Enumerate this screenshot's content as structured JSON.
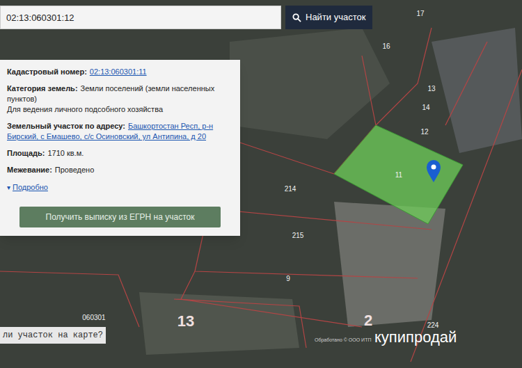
{
  "search": {
    "value": "02:13:060301:12",
    "button": "Найти участок"
  },
  "info": {
    "fields": [
      {
        "label": "Кадастровый номер:",
        "value": "02:13:060301:11",
        "kind": "link"
      },
      {
        "label": "Категория земель:",
        "value": "Земли поселений (земли населенных пунктов)",
        "kind": "text",
        "note": "Для ведения личного подсобного хозяйства"
      },
      {
        "label": "Земельный участок по адресу:",
        "value": "Башкортостан Респ, р-н Бирский, с Емашево, с/с Осиновский, ул Антипина, д 20",
        "kind": "link"
      },
      {
        "label": "Площадь:",
        "value": "1710 кв.м.",
        "kind": "text"
      },
      {
        "label": "Межевание:",
        "value": "Проведено",
        "kind": "text"
      }
    ],
    "details": {
      "icon": "▾",
      "label": "Подробно",
      "expanded": false
    },
    "button": "Получить выписку из ЕГРН на участок"
  },
  "map": {
    "labels": [
      {
        "text": "17",
        "kind": "small"
      },
      {
        "text": "16",
        "kind": "small"
      },
      {
        "text": "13",
        "kind": "small"
      },
      {
        "text": "14",
        "kind": "small"
      },
      {
        "text": "12",
        "kind": "small"
      },
      {
        "text": "11",
        "kind": "small"
      },
      {
        "text": "214",
        "kind": "small"
      },
      {
        "text": "215",
        "kind": "small"
      },
      {
        "text": "9",
        "kind": "small"
      },
      {
        "text": "060301",
        "kind": "small"
      },
      {
        "text": "13",
        "kind": "big"
      },
      {
        "text": "2",
        "kind": "big"
      },
      {
        "text": "224",
        "kind": "small"
      }
    ],
    "hint": "ли участок на карте?",
    "attribution": "Обработано © ООО ИТП",
    "watermark": "купипродай"
  }
}
